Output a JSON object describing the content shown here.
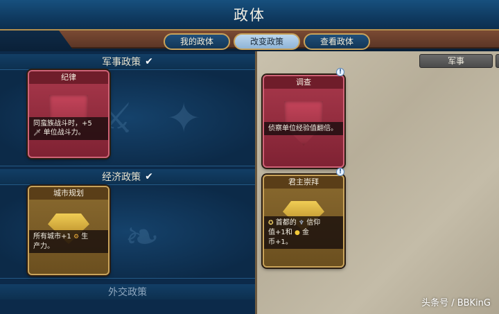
{
  "header": {
    "title": "政体"
  },
  "tabs": [
    {
      "label": "我的政体",
      "active": false
    },
    {
      "label": "改变政策",
      "active": true
    },
    {
      "label": "查看政体",
      "active": false
    }
  ],
  "sections": {
    "military": {
      "title": "军事政策",
      "check": "✔"
    },
    "economic": {
      "title": "经济政策",
      "check": "✔"
    },
    "diplomatic": {
      "title": "外交政策"
    }
  },
  "slotted_cards": {
    "military": {
      "name": "纪律",
      "desc_line1": "同蛮族战斗时，+5",
      "desc_line2": "单位战斗力。",
      "icon": "sword-icon"
    },
    "economic": {
      "name": "城市规划",
      "desc_part1": "所有城市+1",
      "desc_part2": "生",
      "desc_part3": "产力。",
      "icon": "production-gear-icon"
    }
  },
  "available": {
    "tab": "军事",
    "cards": [
      {
        "name": "调查",
        "desc": "侦察单位经验值翻倍。",
        "badge": "!"
      },
      {
        "name": "君主崇拜",
        "desc_part1": "首都的",
        "desc_part2": "信仰",
        "desc_part3": "值+1和",
        "desc_part4": "金",
        "desc_part5": "币+1。",
        "badge": "!"
      }
    ]
  },
  "watermark": "头条号 / BBKinG",
  "colors": {
    "military_card": "#a8384b",
    "economic_card": "#8a6a2f",
    "title_bar": "#17507e",
    "parchment": "#c4bca8"
  }
}
